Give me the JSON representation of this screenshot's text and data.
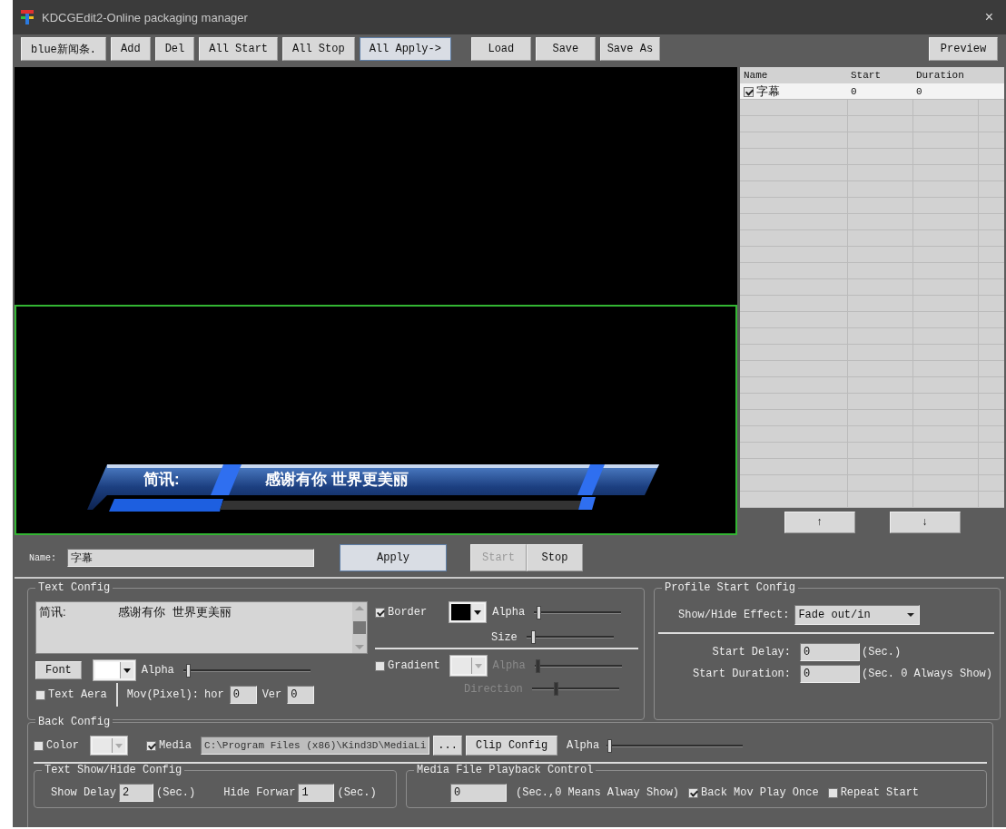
{
  "window": {
    "title": "KDCGEdit2-Online packaging manager",
    "close": "×"
  },
  "toolbar": {
    "left": [
      {
        "label": "blue新闻条.",
        "focused": false
      },
      {
        "label": "Add",
        "focused": false
      },
      {
        "label": "Del",
        "focused": false
      },
      {
        "label": "All Start",
        "focused": false
      },
      {
        "label": "All Stop",
        "focused": false
      },
      {
        "label": "All Apply->",
        "focused": true
      }
    ],
    "file": [
      {
        "label": "Load",
        "focused": false
      },
      {
        "label": "Save",
        "focused": false
      },
      {
        "label": "Save As",
        "focused": false
      }
    ],
    "right": [
      {
        "label": "Preview",
        "focused": false
      }
    ]
  },
  "preview": {
    "caption_label": "简讯:",
    "caption_text": "感谢有你 世界更美丽"
  },
  "layer_list": {
    "columns": [
      "Name",
      "Start",
      "Duration"
    ],
    "rows": [
      {
        "name": "字幕",
        "checked": true,
        "selected": true,
        "start": "0",
        "duration": "0"
      }
    ],
    "up": "↑",
    "down": "↓"
  },
  "name_row": {
    "label": "Name:",
    "value": "字幕",
    "buttons": [
      {
        "label": "Apply",
        "disabled": false,
        "focused": true
      },
      {
        "label": "Start",
        "disabled": true,
        "focused": false
      },
      {
        "label": "Stop",
        "disabled": false,
        "focused": false
      }
    ]
  },
  "text_config": {
    "title": "Text Config",
    "text": "简讯:                感谢有你  世界更美丽",
    "border": {
      "label": "Border",
      "checked": true,
      "color": "#000000"
    },
    "border_alpha": {
      "label": "Alpha",
      "disabled": false,
      "level": 0.05
    },
    "size": {
      "label": "Size",
      "disabled": false,
      "level": 0.08
    },
    "gradient": {
      "label": "Gradient",
      "checked": false,
      "color": "#e8e8e8",
      "color_disabled": true
    },
    "gradient_alpha": {
      "label": "Alpha",
      "disabled": true,
      "level": 0.04
    },
    "direction": {
      "label": "Direction",
      "disabled": true,
      "level": 0.27
    },
    "font": {
      "label": "Font",
      "color": "#ffffff"
    },
    "font_alpha": {
      "label": "Alpha",
      "disabled": false,
      "level": 0.04
    },
    "text_area": {
      "label": "Text Aera",
      "checked": false
    },
    "move": {
      "label": "Mov(Pixel):",
      "hor_label": "hor",
      "hor": "0",
      "ver_label": "Ver",
      "ver": "0"
    }
  },
  "profile": {
    "title": "Profile Start Config",
    "effect_label": "Show/Hide Effect:",
    "effect": "Fade out/in",
    "delay_label": "Start Delay:",
    "delay": "0",
    "delay_unit": "(Sec.)",
    "duration_label": "Start Duration:",
    "duration": "0",
    "duration_unit": "(Sec. 0 Always Show)"
  },
  "back_config": {
    "title": "Back Config",
    "color": {
      "label": "Color",
      "checked": false,
      "color": "#e8e8e8",
      "color_disabled": true
    },
    "media": {
      "label": "Media",
      "checked": true,
      "path": "C:\\Program Files (x86)\\Kind3D\\MediaLi",
      "browse": "...",
      "clip": "Clip Config"
    },
    "alpha": {
      "label": "Alpha",
      "disabled": false,
      "level": 0.02
    },
    "text_show_hide": {
      "title": "Text Show/Hide Config",
      "show_label": "Show Delay",
      "show": "2",
      "show_unit": "(Sec.)",
      "hide_label": "Hide Forwar",
      "hide": "1",
      "hide_unit": "(Sec.)"
    },
    "media_playback": {
      "title": "Media File Playback Control",
      "value": "0",
      "note": "(Sec.,0 Means Alway Show)",
      "back_mov": {
        "label": "Back Mov Play Once",
        "checked": true
      },
      "repeat": {
        "label": "Repeat Start",
        "checked": false
      }
    }
  }
}
